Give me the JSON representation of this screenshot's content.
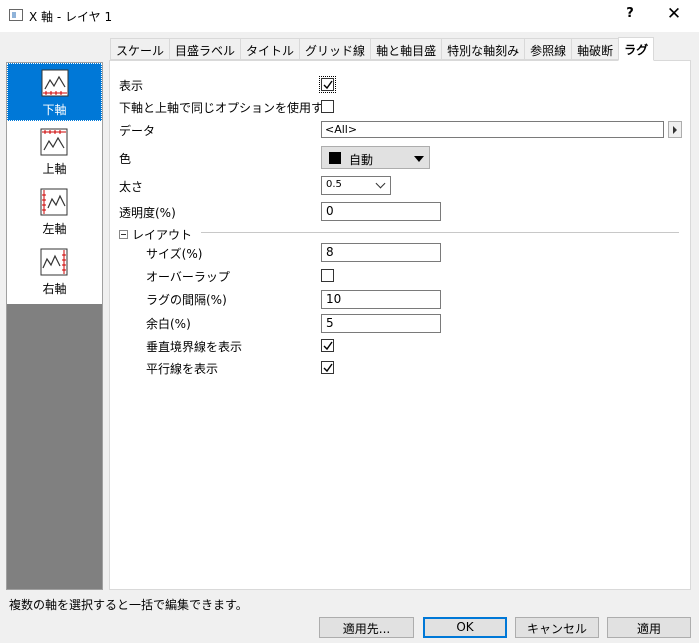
{
  "window": {
    "title": "X 軸 - レイヤ 1",
    "help_label": "?",
    "close_label": "✕"
  },
  "sidebar": {
    "items": [
      {
        "label": "下軸",
        "icon": "bottom-axis-icon",
        "active": true
      },
      {
        "label": "上軸",
        "icon": "top-axis-icon",
        "active": false
      },
      {
        "label": "左軸",
        "icon": "left-axis-icon",
        "active": false
      },
      {
        "label": "右軸",
        "icon": "right-axis-icon",
        "active": false
      }
    ]
  },
  "tabs": [
    {
      "label": "スケール"
    },
    {
      "label": "目盛ラベル"
    },
    {
      "label": "タイトル"
    },
    {
      "label": "グリッド線"
    },
    {
      "label": "軸と軸目盛"
    },
    {
      "label": "特別な軸刻み"
    },
    {
      "label": "参照線"
    },
    {
      "label": "軸破断"
    },
    {
      "label": "ラグ",
      "active": true
    }
  ],
  "form": {
    "show_label": "表示",
    "show_checked": true,
    "same_option_label": "下軸と上軸で同じオプションを使用する",
    "same_option_checked": false,
    "data_label": "データ",
    "data_value": "<All>",
    "color_label": "色",
    "color_value": "自動",
    "color_swatch": "#000000",
    "thickness_label": "太さ",
    "thickness_value": "0.5",
    "transparency_label": "透明度(%)",
    "transparency_value": "0",
    "layout": {
      "group_label": "レイアウト",
      "size_label": "サイズ(%)",
      "size_value": "8",
      "overlap_label": "オーバーラップ",
      "overlap_checked": false,
      "spacing_label": "ラグの間隔(%)",
      "spacing_value": "10",
      "margin_label": "余白(%)",
      "margin_value": "5",
      "vertical_border_label": "垂直境界線を表示",
      "vertical_border_checked": true,
      "parallel_label": "平行線を表示",
      "parallel_checked": true
    }
  },
  "status": {
    "text": "複数の軸を選択すると一括で編集できます。"
  },
  "buttons": {
    "apply_to": "適用先...",
    "ok": "OK",
    "cancel": "キャンセル",
    "apply": "適用"
  },
  "colors": {
    "accent": "#0078d7",
    "sidebar_bg": "#808080"
  }
}
